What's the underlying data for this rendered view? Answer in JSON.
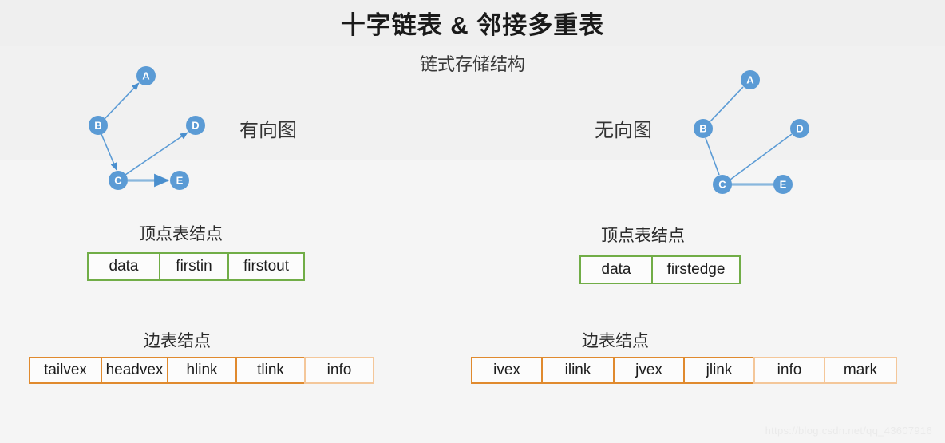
{
  "title": "十字链表 & 邻接多重表",
  "subtitle": "链式存储结构",
  "left": {
    "graph_label": "有向图",
    "vertex_heading": "顶点表结点",
    "edge_heading": "边表结点",
    "vertex_cells": [
      "data",
      "firstin",
      "firstout"
    ],
    "edge_cells": [
      "tailvex",
      "headvex",
      "hlink",
      "tlink",
      "info"
    ],
    "nodes": [
      "A",
      "B",
      "C",
      "D",
      "E"
    ],
    "edges": [
      "B->A",
      "B->C",
      "C->D",
      "C->E"
    ]
  },
  "right": {
    "graph_label": "无向图",
    "vertex_heading": "顶点表结点",
    "edge_heading": "边表结点",
    "vertex_cells": [
      "data",
      "firstedge"
    ],
    "edge_cells": [
      "ivex",
      "ilink",
      "jvex",
      "jlink",
      "info",
      "mark"
    ],
    "nodes": [
      "A",
      "B",
      "C",
      "D",
      "E"
    ],
    "edges": [
      "A-B",
      "B-C",
      "C-D",
      "C-E"
    ]
  },
  "watermark": "https://blog.csdn.net/qq_43607916",
  "colors": {
    "node_blue": "#5b9bd5",
    "vertex_border_green": "#71ad47",
    "edge_border_orange": "#e08a2e",
    "edge_border_orange_faded": "#f4c79a",
    "background": "#f4f4f4",
    "title_text": "#1a1a1a"
  }
}
